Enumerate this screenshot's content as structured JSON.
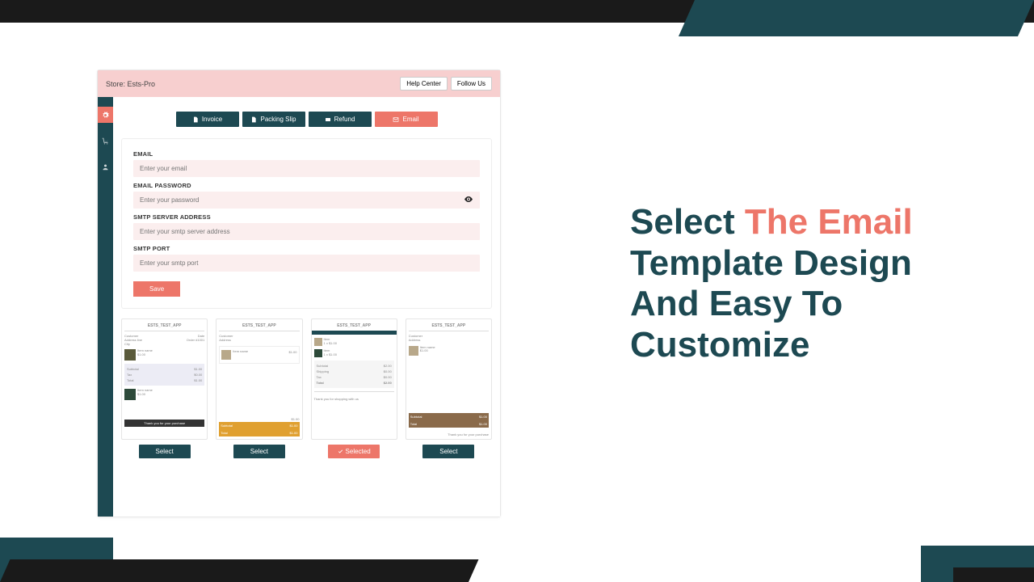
{
  "headline": {
    "pre": "Select ",
    "accent": "The Email",
    "rest": " Template Design And Easy To Customize"
  },
  "header": {
    "store": "Store: Ests-Pro",
    "help": "Help Center",
    "follow": "Follow Us"
  },
  "sidebar": {
    "items": [
      "settings",
      "cart",
      "user"
    ]
  },
  "tabs": {
    "invoice": "Invoice",
    "packing": "Packing Slip",
    "refund": "Refund",
    "email": "Email"
  },
  "form": {
    "email_label": "EMAIL",
    "email_ph": "Enter your email",
    "pwd_label": "EMAIL PASSWORD",
    "pwd_ph": "Enter your password",
    "smtp_label": "SMTP SERVER ADDRESS",
    "smtp_ph": "Enter your smtp server address",
    "port_label": "SMTP PORT",
    "port_ph": "Enter your smtp port",
    "save": "Save"
  },
  "templates": {
    "select": "Select",
    "selected": "Selected",
    "preview_title": "ESTS_TEST_APP",
    "cta": "Thank you for your purchase"
  }
}
